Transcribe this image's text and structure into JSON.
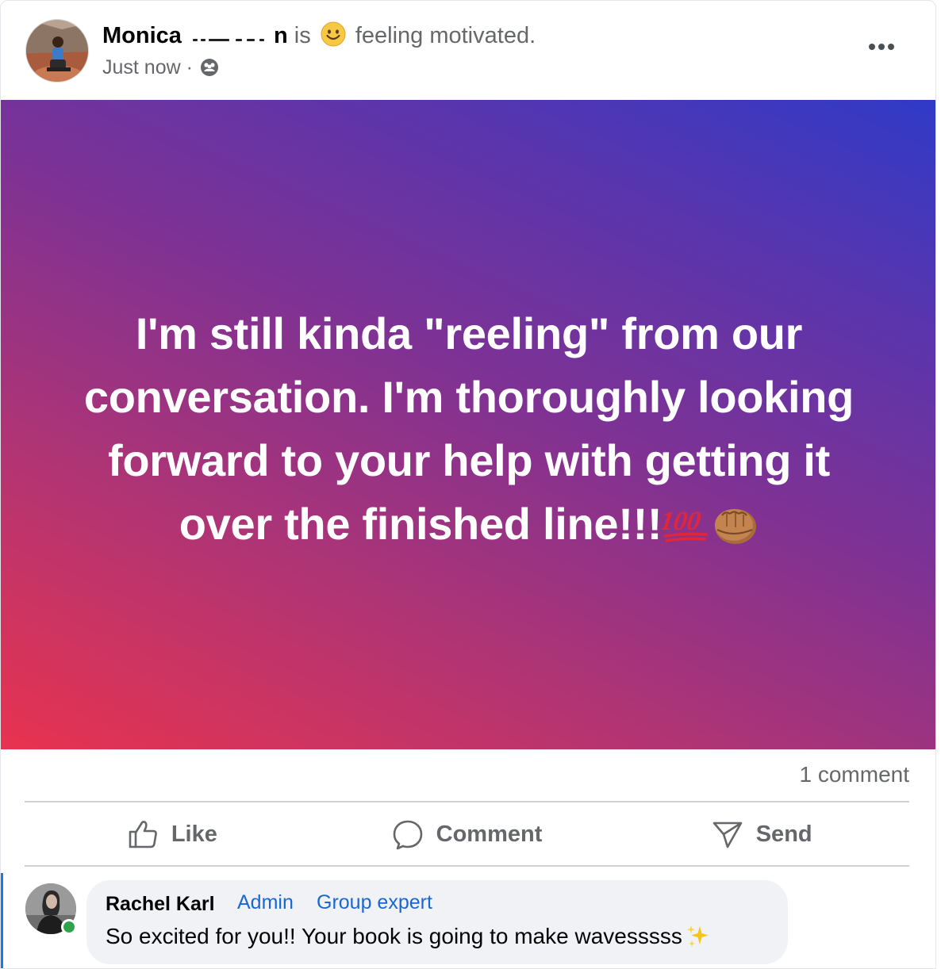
{
  "post": {
    "author_visible": "Monica",
    "author_tail": "n",
    "is_word": "is",
    "feeling": "feeling motivated.",
    "feeling_icon": "smiling-emoji-icon",
    "timestamp": "Just now",
    "separator": "·",
    "audience_icon": "group-audience-icon",
    "more_icon": "more-options-icon"
  },
  "banner": {
    "lines": [
      "I'm still kinda \"reeling\" from our",
      "conversation. I'm thoroughly looking",
      "forward to your help with getting it",
      "over the finished line!!!"
    ],
    "trailing_emojis": [
      "hundred-points-emoji",
      "fist-bump-emoji"
    ],
    "gradient": [
      "#e8334f",
      "#b8346f",
      "#7e3294",
      "#5a35ad",
      "#2f3ac7"
    ]
  },
  "stats": {
    "comments": "1 comment"
  },
  "actions": {
    "like": "Like",
    "comment": "Comment",
    "send": "Send"
  },
  "comment": {
    "author": "Rachel Karl",
    "badge_admin": "Admin",
    "badge_expert": "Group expert",
    "text": "So excited for you!! Your book is going to make wavesssss",
    "text_emoji": "sparkles-emoji",
    "online": true,
    "accent": "#1877f2"
  }
}
